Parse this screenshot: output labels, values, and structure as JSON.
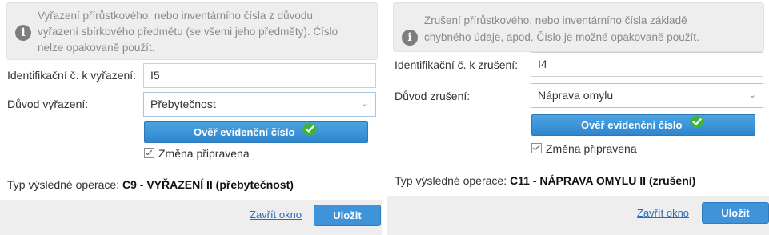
{
  "left": {
    "info_line_1": "Vyřazení přírůstkového, nebo inventárního čísla z důvodu",
    "info_line_2": "vyřazení sbírkového předmětu (se všemi jeho předměty). Číslo",
    "info_line_3": "nelze opakovaně použít.",
    "id_label": "Identifikační č. k vyřazení:",
    "id_value": "I5",
    "reason_label": "Důvod vyřazení:",
    "reason_value": "Přebytečnost",
    "verify_label": "Ověř evidenční číslo",
    "checkbox_label": "Změna připravena",
    "op_label": "Typ výsledné operace:",
    "op_value": "C9 - VYŘAZENÍ II (přebytečnost)",
    "close_label": "Zavřít okno",
    "save_label": "Uložit"
  },
  "right": {
    "info_line_1": "Zrušení přírůstkového, nebo inventárního čísla základě",
    "info_line_2": "chybného údaje, apod. Číslo je možné opakovaně použít.",
    "id_label": "Identifikační č. k zrušení:",
    "id_value": "I4",
    "reason_label": "Důvod zrušení:",
    "reason_value": "Náprava omylu",
    "verify_label": "Ověř evidenční číslo",
    "checkbox_label": "Změna připravena",
    "op_label": "Typ výsledné operace:",
    "op_value": "C11 - NÁPRAVA OMYLU II (zrušení)",
    "close_label": "Zavřít okno",
    "save_label": "Uložit"
  },
  "icons": {
    "info": "info-circle-icon",
    "verified": "check-badge-icon",
    "dropdown": "chevron-down-icon"
  },
  "colors": {
    "accent_blue": "#3e93d9",
    "link_blue": "#2a6ebb",
    "success_green": "#3cb43c",
    "info_bg": "#eeeeee"
  }
}
